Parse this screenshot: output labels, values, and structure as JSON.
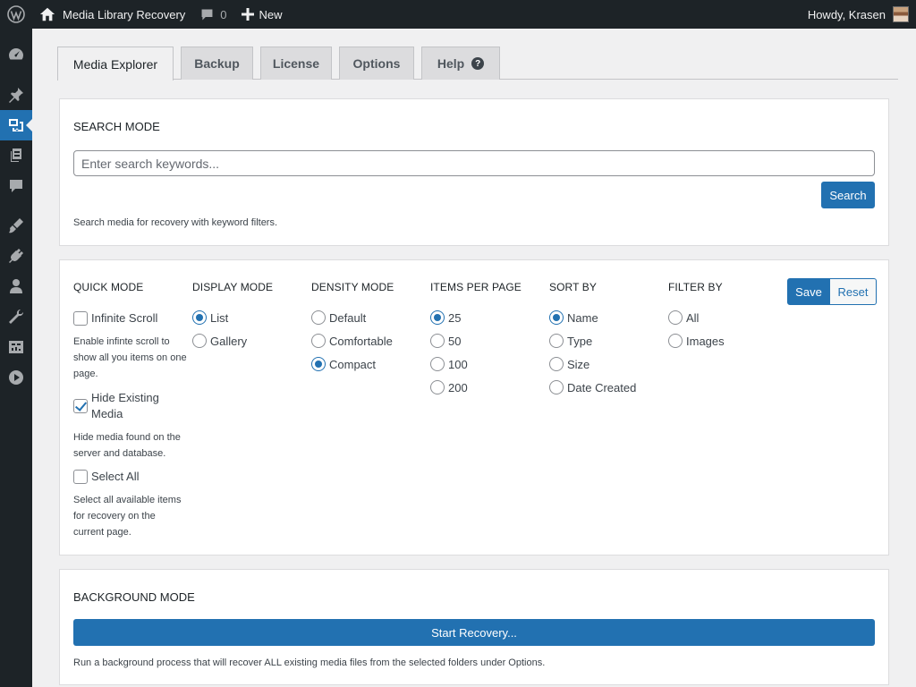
{
  "adminbar": {
    "site_title": "Media Library Recovery",
    "comments_count": "0",
    "new_label": "New",
    "greeting": "Howdy, Krasen"
  },
  "tabs": [
    {
      "label": "Media Explorer"
    },
    {
      "label": "Backup"
    },
    {
      "label": "License"
    },
    {
      "label": "Options"
    },
    {
      "label": "Help"
    }
  ],
  "search_panel": {
    "heading": "SEARCH MODE",
    "placeholder": "Enter search keywords...",
    "value": "",
    "button": "Search",
    "description": "Search media for recovery with keyword filters."
  },
  "options_panel": {
    "quick_mode": {
      "heading": "QUICK MODE",
      "items": [
        {
          "label": "Infinite Scroll",
          "checked": false,
          "desc": "Enable infinte scroll to show all you items on one page."
        },
        {
          "label": "Hide Existing Media",
          "checked": true,
          "desc": "Hide media found on the server and database."
        },
        {
          "label": "Select All",
          "checked": false,
          "desc": "Select all available items for recovery on the current page."
        }
      ]
    },
    "display_mode": {
      "heading": "DISPLAY MODE",
      "options": [
        "List",
        "Gallery"
      ],
      "selected": "List"
    },
    "density_mode": {
      "heading": "DENSITY MODE",
      "options": [
        "Default",
        "Comfortable",
        "Compact"
      ],
      "selected": "Compact"
    },
    "items_per_page": {
      "heading": "ITEMS PER PAGE",
      "options": [
        "25",
        "50",
        "100",
        "200"
      ],
      "selected": "25"
    },
    "sort_by": {
      "heading": "SORT BY",
      "options": [
        "Name",
        "Type",
        "Size",
        "Date Created"
      ],
      "selected": "Name"
    },
    "filter_by": {
      "heading": "FILTER BY",
      "options": [
        "All",
        "Images"
      ],
      "selected": ""
    },
    "save_label": "Save",
    "reset_label": "Reset"
  },
  "background_panel": {
    "heading": "BACKGROUND MODE",
    "button": "Start Recovery...",
    "description": "Run a background process that will recover ALL existing media files from the selected folders under Options."
  },
  "colors": {
    "accent": "#2271b1",
    "sidebar": "#1d2327",
    "background": "#f0f0f1"
  },
  "sidebar_icons": [
    "dashboard-icon",
    "pin-icon",
    "media-icon",
    "pages-icon",
    "comments-icon",
    "appearance-icon",
    "plugins-icon",
    "users-icon",
    "tools-icon",
    "settings-icon",
    "collapse-icon"
  ]
}
